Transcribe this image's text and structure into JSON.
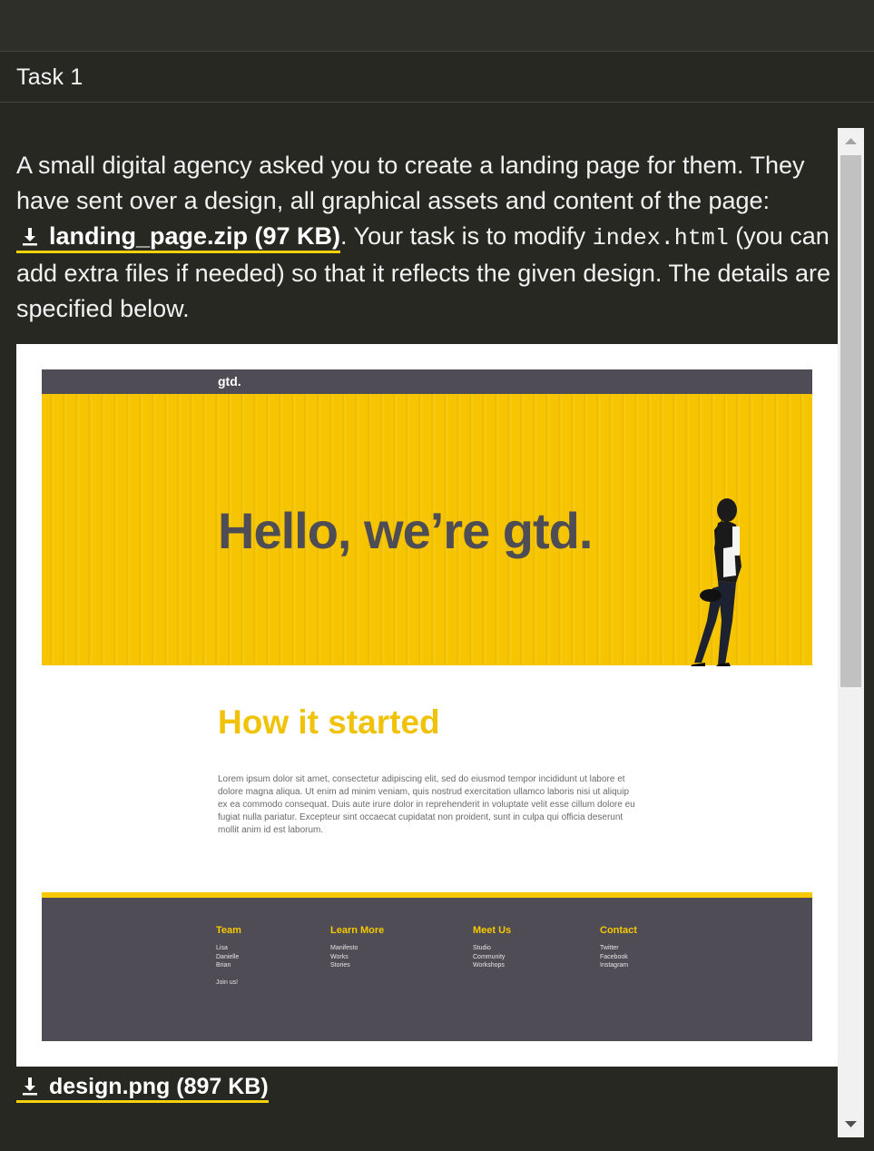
{
  "header": {
    "title": "Task 1"
  },
  "task": {
    "intro": "A small digital agency asked you to create a landing page for them. They have sent over a design, all graphical assets and content of the page: ",
    "zip_link": "landing_page.zip (97 KB)",
    "mid": ". Your task is to modify ",
    "code_file": "index.html",
    "outro": " (you can add extra files if needed) so that it reflects the given design. The details are specified below."
  },
  "design_preview": {
    "logo": "gtd.",
    "hero_title": "Hello, we’re gtd.",
    "section_title": "How it started",
    "body": "Lorem ipsum dolor sit amet, consectetur adipiscing elit, sed do eiusmod tempor incididunt ut labore et dolore magna aliqua. Ut enim ad minim veniam, quis nostrud exercitation ullamco laboris nisi ut aliquip ex ea commodo consequat. Duis aute irure dolor in reprehenderit in voluptate velit esse cillum dolore eu fugiat nulla pariatur. Excepteur sint occaecat cupidatat non proident, sunt in culpa qui officia deserunt mollit anim id est laborum.",
    "footer": {
      "team": {
        "heading": "Team",
        "items": [
          "Lisa",
          "Danielle",
          "Brian"
        ],
        "extra": "Join us!"
      },
      "learn": {
        "heading": "Learn More",
        "items": [
          "Manifesto",
          "Works",
          "Stories"
        ]
      },
      "meet": {
        "heading": "Meet Us",
        "items": [
          "Studio",
          "Community",
          "Workshops"
        ]
      },
      "contact": {
        "heading": "Contact",
        "items": [
          "Twitter",
          "Facebook",
          "Instagram"
        ]
      }
    }
  },
  "design_link": "design.png (897 KB)",
  "colors": {
    "background": "#272822",
    "accent": "#f5d20c",
    "hero_yellow": "#f6c400",
    "dark_gray": "#4f4c55"
  },
  "icons": {
    "download": "download-icon",
    "scroll_up": "arrow-up-icon",
    "scroll_down": "arrow-down-icon"
  }
}
